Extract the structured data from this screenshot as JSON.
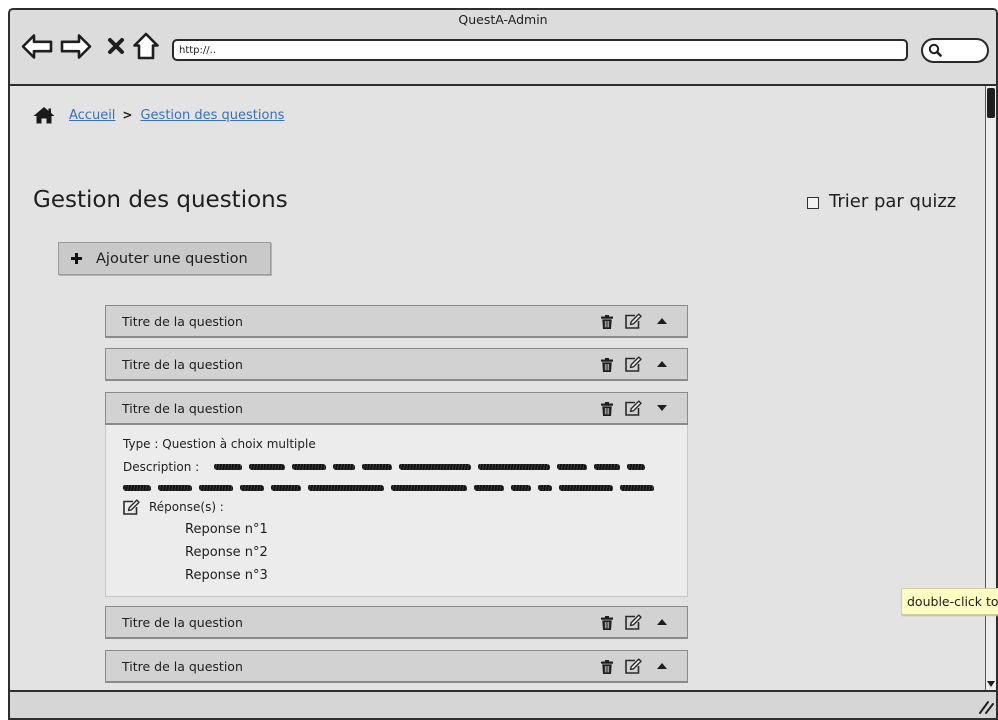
{
  "colors": {
    "frame": "#2e2e2e",
    "chrome": "#dcdcdc",
    "content": "#e3e3e3",
    "link": "#3b6fb5",
    "row": "#d2d2d2",
    "panel": "#ececec",
    "button": "#c9c9c9",
    "tooltip": "#fdfdc4"
  },
  "window": {
    "title": "QuestA-Admin"
  },
  "toolbar": {
    "icons": [
      "back-arrow-icon",
      "forward-arrow-icon",
      "stop-icon",
      "home-icon"
    ],
    "url": "http://..",
    "search_icon": "search-icon"
  },
  "breadcrumb": {
    "home_icon": "home-icon",
    "items": [
      "Accueil",
      "Gestion des questions"
    ],
    "separator": ">"
  },
  "page": {
    "title": "Gestion des questions",
    "sort_checkbox": {
      "label": "Trier par quizz",
      "checked": false
    },
    "add_button": {
      "label": "Ajouter une question",
      "icon": "plus-icon"
    }
  },
  "questions": [
    {
      "title": "Titre de la question",
      "expanded": false,
      "actions": [
        "trash-icon",
        "edit-icon"
      ],
      "toggle_icon": "caret-up-icon"
    },
    {
      "title": "Titre de la question",
      "expanded": false,
      "actions": [
        "trash-icon",
        "edit-icon"
      ],
      "toggle_icon": "caret-up-icon"
    },
    {
      "title": "Titre de la question",
      "expanded": true,
      "actions": [
        "trash-icon",
        "edit-icon"
      ],
      "toggle_icon": "caret-down-icon",
      "details": {
        "type_label": "Type :",
        "type_value": "Question à choix multiple",
        "description_label": "Description :",
        "answers_icon": "edit-icon",
        "answers_label": "Réponse(s) :",
        "answers": [
          "Reponse n°1",
          "Reponse n°2",
          "Reponse n°3"
        ]
      }
    },
    {
      "title": "Titre de la question",
      "expanded": false,
      "actions": [
        "trash-icon",
        "edit-icon"
      ],
      "toggle_icon": "caret-up-icon"
    },
    {
      "title": "Titre de la question",
      "expanded": false,
      "actions": [
        "trash-icon",
        "edit-icon"
      ],
      "toggle_icon": "caret-up-icon"
    }
  ],
  "tooltip": {
    "text": "double-click to"
  },
  "statusbar": {
    "icon": "resize-grip-icon"
  }
}
